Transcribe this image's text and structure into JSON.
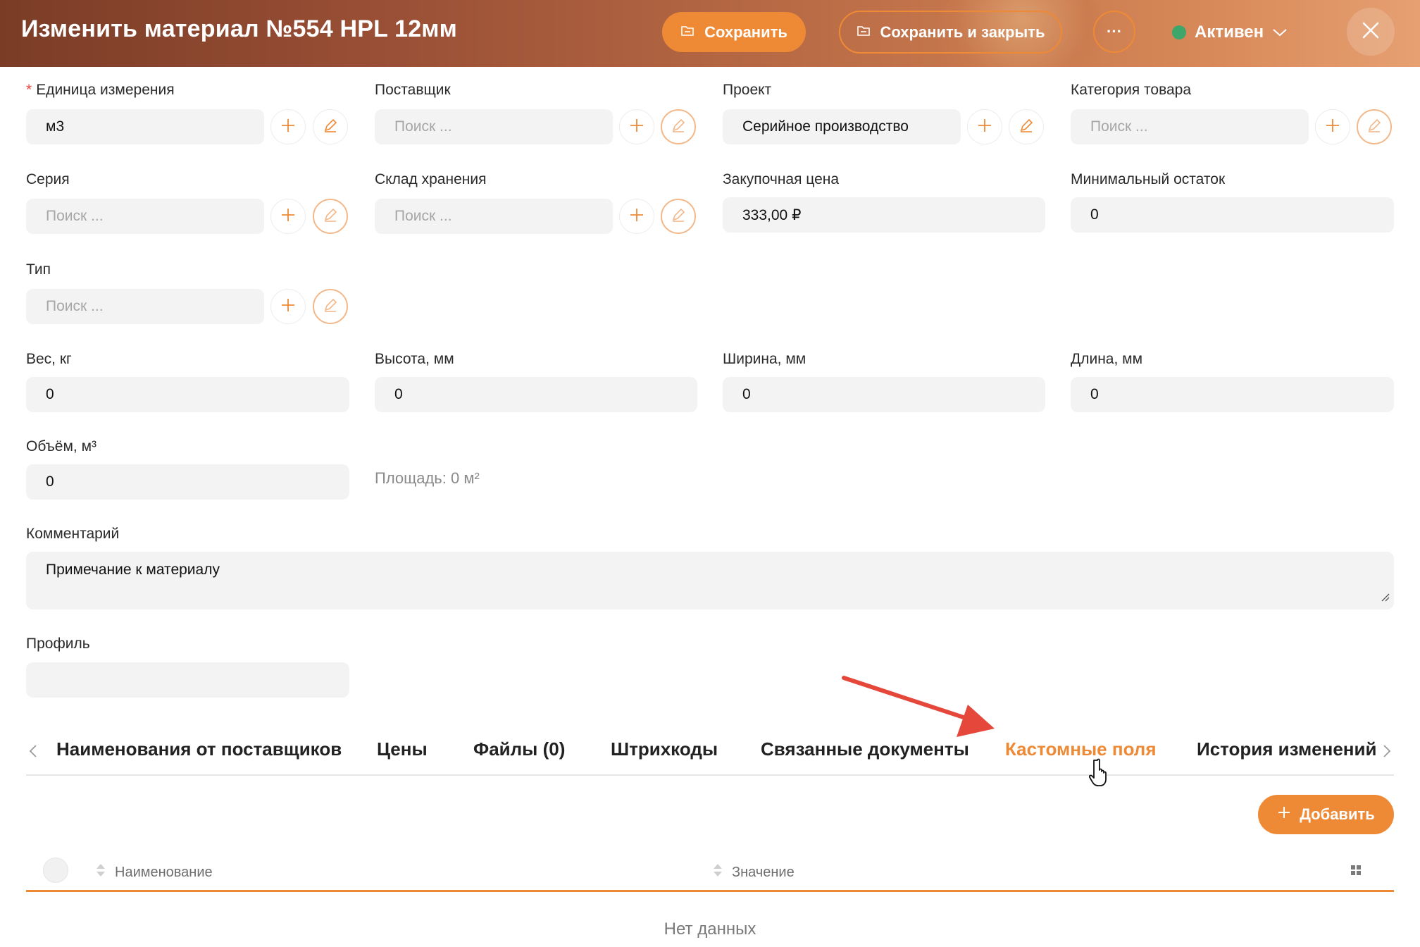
{
  "header": {
    "title": "Изменить материал №554 HPL 12мм",
    "save_label": "Сохранить",
    "save_close_label": "Сохранить и закрыть",
    "more_label": "···",
    "status_label": "Активен",
    "status_color": "#3ea66b",
    "close_icon": "close-icon"
  },
  "form": {
    "unit": {
      "label": "Единица измерения",
      "required": "*",
      "value": "м3"
    },
    "supplier": {
      "label": "Поставщик",
      "placeholder": "Поиск ..."
    },
    "project": {
      "label": "Проект",
      "value": "Серийное производство"
    },
    "category": {
      "label": "Категория товара",
      "placeholder": "Поиск ..."
    },
    "series": {
      "label": "Серия",
      "placeholder": "Поиск ..."
    },
    "warehouse": {
      "label": "Склад хранения",
      "placeholder": "Поиск ..."
    },
    "purchase_price": {
      "label": "Закупочная цена",
      "value": "333,00 ₽"
    },
    "min_stock": {
      "label": "Минимальный остаток",
      "value": "0"
    },
    "type": {
      "label": "Тип",
      "placeholder": "Поиск ..."
    },
    "weight": {
      "label": "Вес, кг",
      "value": "0"
    },
    "height": {
      "label": "Высота, мм",
      "value": "0"
    },
    "width": {
      "label": "Ширина, мм",
      "value": "0"
    },
    "length": {
      "label": "Длина, мм",
      "value": "0"
    },
    "volume": {
      "label": "Объём, м³",
      "value": "0"
    },
    "area": "Площадь: 0 м²",
    "comment": {
      "label": "Комментарий",
      "value": "Примечание к материалу"
    },
    "profile": {
      "label": "Профиль",
      "value": ""
    }
  },
  "tabs": [
    {
      "label": "Наименования от поставщиков"
    },
    {
      "label": "Цены"
    },
    {
      "label": "Файлы (0)"
    },
    {
      "label": "Штрихкоды"
    },
    {
      "label": "Связанные документы"
    },
    {
      "label": "Кастомные поля",
      "active": true
    },
    {
      "label": "История изменений"
    }
  ],
  "add_button": "Добавить",
  "table": {
    "columns": [
      "Наименование",
      "Значение"
    ],
    "empty_text": "Нет данных"
  },
  "colors": {
    "accent": "#ee8a36",
    "annotation_arrow": "#e5483b"
  }
}
